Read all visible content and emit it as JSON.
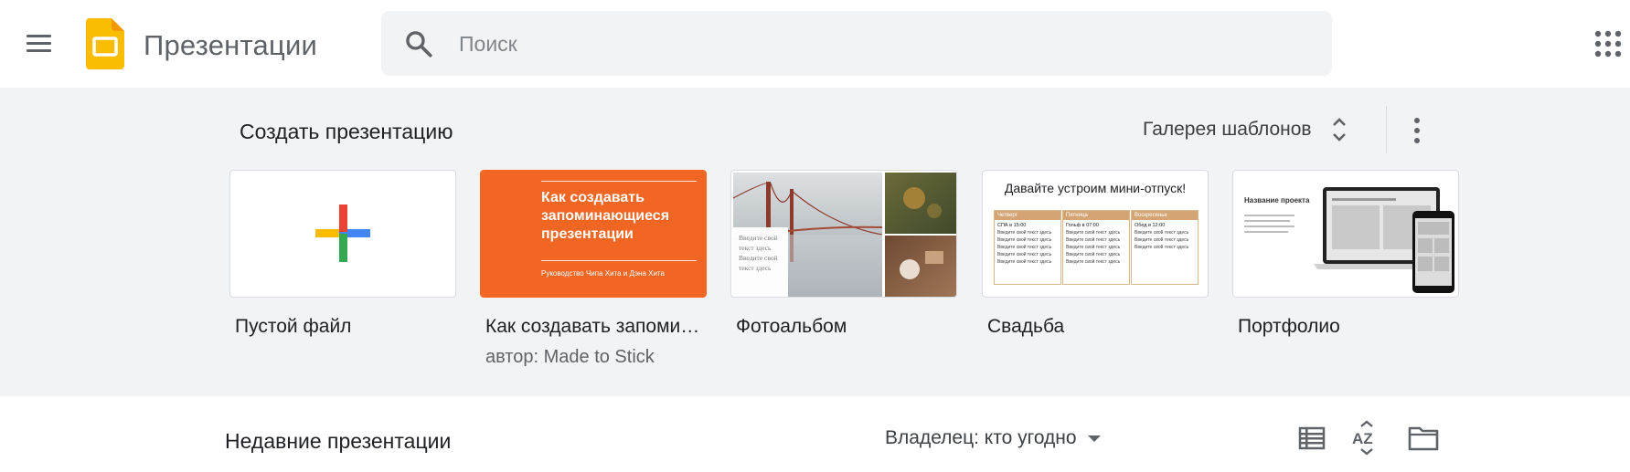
{
  "header": {
    "app_title": "Презентации",
    "search_placeholder": "Поиск",
    "icons": {
      "menu": "hamburger-menu-icon",
      "logo": "slides-logo",
      "search": "search-icon",
      "apps": "apps-grid-icon"
    }
  },
  "gallery": {
    "title": "Создать презентацию",
    "toggle_label": "Галерея шаблонов",
    "templates": [
      {
        "name": "Пустой файл",
        "subtitle": ""
      },
      {
        "name": "Как создавать запоминающиеся презентации",
        "subtitle": "автор: Made to Stick",
        "thumb_title": "Как создавать запоминающиеся презентации",
        "thumb_subtitle": "Руководство Чипа Хита и Дэна Хита"
      },
      {
        "name": "Фотоальбом",
        "subtitle": "",
        "thumb_caption": "Введите свой текст здесь Введите свой текст здесь"
      },
      {
        "name": "Свадьба",
        "subtitle": "",
        "thumb_title": "Давайте устроим мини-отпуск!",
        "columns": [
          {
            "day": "Четверг",
            "event": "СПА в 15:00"
          },
          {
            "day": "Пятница",
            "event": "Гольф в 07:00"
          },
          {
            "day": "Воскресенье",
            "event": "Обед в 12:00"
          }
        ],
        "filler": "Введите свой текст здесь"
      },
      {
        "name": "Портфолио",
        "subtitle": "",
        "thumb_title": "Название проекта"
      }
    ]
  },
  "recent": {
    "title": "Недавние презентации",
    "owner_filter": "Владелец: кто угодно",
    "icons": {
      "list_view": "list-view-icon",
      "sort": "sort-az-icon",
      "folder": "folder-icon"
    }
  },
  "colors": {
    "accent_orange": "#f26624",
    "slides_yellow": "#fbbc04",
    "gallery_bg": "#f1f3f4"
  }
}
